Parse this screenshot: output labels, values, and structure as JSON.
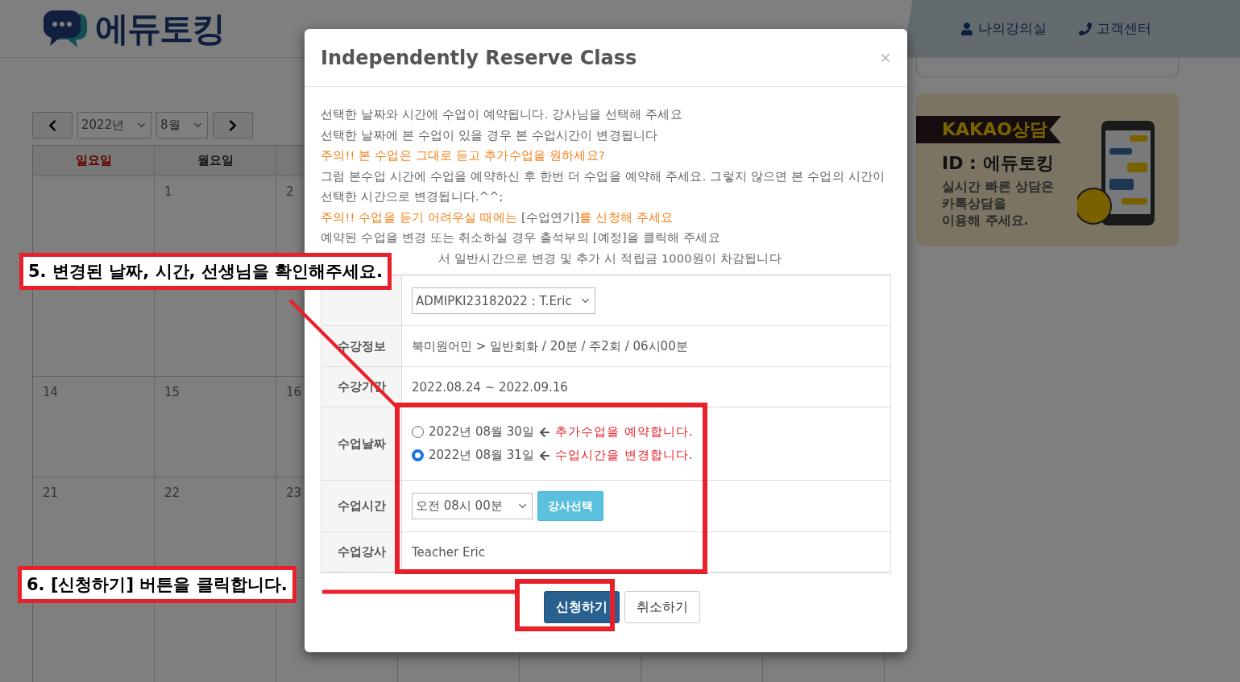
{
  "header": {
    "logo": "에듀토킹",
    "links": [
      "나의강의실",
      "고객센터"
    ]
  },
  "calendar": {
    "year": "2022년",
    "month": "8월",
    "weekdays": [
      {
        "label": "일요일",
        "kind": "holiday"
      },
      {
        "label": "월요일",
        "kind": "weekday"
      }
    ],
    "rows": [
      [
        "",
        "1",
        "2"
      ],
      [
        "",
        "",
        ""
      ],
      [
        "14",
        "15",
        "16"
      ],
      [
        "21",
        "22",
        "23"
      ],
      [
        "",
        "",
        ""
      ]
    ]
  },
  "kakao_banner": {
    "badge": "KAKAO상담",
    "id": "ID : 에듀토킹",
    "message": "실시간 빠른 상담은\n카톡상담을\n이용해 주세요."
  },
  "modal": {
    "title": "Independently Reserve Class",
    "close": "×",
    "notices": [
      [
        {
          "text": "선택한 날짜와 시간에 수업이 예약됩니다. 강사님을 선택해 주세요",
          "kind": "info"
        }
      ],
      [
        {
          "text": "선택한 날짜에 본 수업이 있을 경우 본 수업시간이 변경됩니다",
          "kind": "info"
        }
      ],
      [
        {
          "text": "주의!! 본 수업은 그대로 듣고 추가수업을 원하세요?",
          "kind": "warning"
        }
      ],
      [
        {
          "text": "그럼 본수업 시간에 수업을 예약하신 후 한번 더 수업을 예약해 주세요. 그렇지 않으면 본 수업의 시간이 선택한 시간으로 변경됩니다.^^;",
          "kind": "info"
        }
      ],
      [
        {
          "text": "주의!! 수업을 듣기 어려우실 때에는 ",
          "kind": "warning"
        },
        {
          "text": "[수업연기]",
          "kind": "info"
        },
        {
          "text": "를 신청해 주세요",
          "kind": "warning"
        }
      ],
      [
        {
          "text": "예약된 수업을 변경 또는 취소하실 경우 출석부의 [예정]을 클릭해 주세요",
          "kind": "info"
        }
      ],
      [
        {
          "text": "서 일반시간으로 변경 및 추가 시 적립금 1000원이 차감됩니다",
          "kind": "hidden-start"
        }
      ]
    ],
    "rows": [
      {
        "kind": "select",
        "value": "ADMIPKI23182022 : T.Eric"
      },
      {
        "kind": "text",
        "label": "수강정보",
        "value": "북미원어민 > 일반회화 / 20분 / 주2회 / 06시00분"
      },
      {
        "kind": "text",
        "label": "수강기간",
        "value": "2022.08.24 ~ 2022.09.16"
      },
      {
        "kind": "radios",
        "label": "수업날짜",
        "options": [
          {
            "date": "2022년 08월 30일",
            "note": "추가수업을 예약합니다.",
            "selected": false
          },
          {
            "date": "2022년 08월 31일",
            "note": "수업시간을 변경합니다.",
            "selected": true
          }
        ]
      },
      {
        "kind": "time",
        "label": "수업시간",
        "value": "오전 08시 00분",
        "button": "강사선택"
      },
      {
        "kind": "text",
        "label": "수업강사",
        "value": "Teacher Eric"
      }
    ],
    "buttons": [
      {
        "label": "신청하기",
        "kind": "primary"
      },
      {
        "label": "취소하기",
        "kind": "default"
      }
    ]
  },
  "annotations": [
    {
      "text": "5. 변경된 날짜, 시간, 선생님을 확인해주세요."
    },
    {
      "text": "6. [신청하기] 버튼을 클릭합니다."
    }
  ]
}
